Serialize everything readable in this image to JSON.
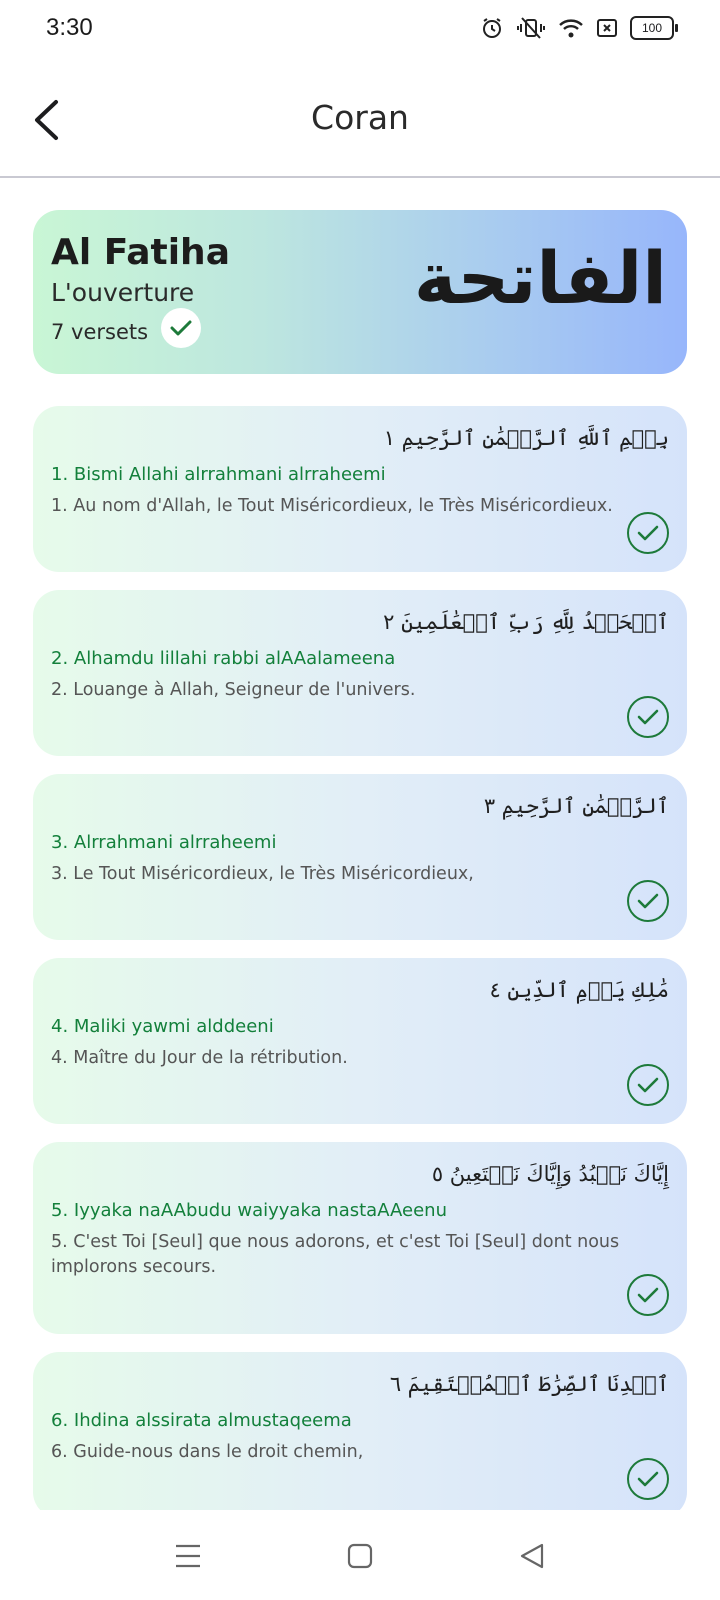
{
  "status": {
    "time": "3:30",
    "battery": "100"
  },
  "app_bar": {
    "title": "Coran"
  },
  "surah": {
    "name": "Al Fatiha",
    "meaning": "L'ouverture",
    "verses_label": "7 versets",
    "arabic_name": "الفاتحة",
    "completed": true
  },
  "verses": [
    {
      "arabic": "بِسۡمِ ٱللَّهِ ٱلرَّحۡمَٰنِ ٱلرَّحِيمِ ١",
      "transliteration": "1. Bismi Allahi alrrahmani alrraheemi",
      "translation": "1. Au nom d'Allah, le Tout Miséricordieux, le Très Miséricordieux.",
      "completed": true
    },
    {
      "arabic": "ٱلۡحَمۡدُ لِلَّهِ رَبِّ ٱلۡعَٰلَمِينَ ٢",
      "transliteration": "2. Alhamdu lillahi rabbi alAAalameena",
      "translation": "2. Louange à Allah, Seigneur de l'univers.",
      "completed": true
    },
    {
      "arabic": "ٱلرَّحۡمَٰنِ ٱلرَّحِيمِ ٣",
      "transliteration": "3. Alrrahmani alrraheemi",
      "translation": "3. Le Tout Miséricordieux, le Très Miséricordieux,",
      "completed": true
    },
    {
      "arabic": "مَٰلِكِ يَوۡمِ ٱلدِّينِ ٤",
      "transliteration": "4. Maliki yawmi alddeeni",
      "translation": "4. Maître du Jour de la rétribution.",
      "completed": true
    },
    {
      "arabic": "إِيَّاكَ نَعۡبُدُ وَإِيَّاكَ نَسۡتَعِينُ ٥",
      "transliteration": "5. Iyyaka naAAbudu waiyyaka nastaAAeenu",
      "translation": "5. C'est Toi [Seul] que nous adorons, et c'est Toi [Seul] dont nous implorons secours.",
      "completed": true
    },
    {
      "arabic": "ٱهۡدِنَا ٱلصِّرَٰطَ ٱلۡمُسۡتَقِيمَ ٦",
      "transliteration": "6. Ihdina alssirata almustaqeema",
      "translation": "6. Guide-nous dans le droit chemin,",
      "completed": true
    }
  ],
  "colors": {
    "accent_green": "#1d7a3a",
    "transliteration_green": "#13803b"
  },
  "icons": {
    "back": "chevron-left-icon",
    "check": "check-icon",
    "nav_menu": "menu-icon",
    "nav_home": "square-icon",
    "nav_back": "triangle-back-icon"
  }
}
